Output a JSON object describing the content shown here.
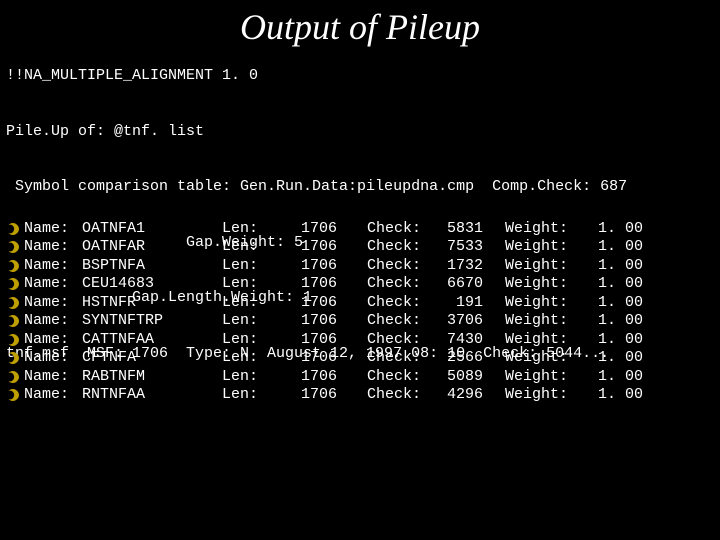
{
  "title": "Output of Pileup",
  "header": {
    "line1": "!!NA_MULTIPLE_ALIGNMENT 1. 0",
    "line2": "Pile.Up of: @tnf. list",
    "line3": " Symbol comparison table: Gen.Run.Data:pileupdna.cmp  Comp.Check: 687",
    "line4": "                    Gap.Weight: 5",
    "line5": "              Gap.Length.Weight: 1",
    "line6": "tnf.msf  MSF: 1706  Type: N  August 12, 1997 08: 10  Check: 5044..."
  },
  "labels": {
    "name": "Name:",
    "len": "Len:",
    "check": "Check:",
    "weight": "Weight:"
  },
  "rows": [
    {
      "name": "OATNFA1",
      "len": "1706",
      "check": "5831",
      "weight": "1. 00"
    },
    {
      "name": "OATNFAR",
      "len": "1706",
      "check": "7533",
      "weight": "1. 00"
    },
    {
      "name": "BSPTNFA",
      "len": "1706",
      "check": "1732",
      "weight": "1. 00"
    },
    {
      "name": "CEU14683",
      "len": "1706",
      "check": "6670",
      "weight": "1. 00"
    },
    {
      "name": "HSTNFR",
      "len": "1706",
      "check": "191",
      "weight": "1. 00"
    },
    {
      "name": "SYNTNFTRP",
      "len": "1706",
      "check": "3706",
      "weight": "1. 00"
    },
    {
      "name": "CATTNFAA",
      "len": "1706",
      "check": "7430",
      "weight": "1. 00"
    },
    {
      "name": "CFTNFA",
      "len": "1706",
      "check": "2566",
      "weight": "1. 00"
    },
    {
      "name": "RABTNFM",
      "len": "1706",
      "check": "5089",
      "weight": "1. 00"
    },
    {
      "name": "RNTNFAA",
      "len": "1706",
      "check": "4296",
      "weight": "1. 00"
    }
  ]
}
